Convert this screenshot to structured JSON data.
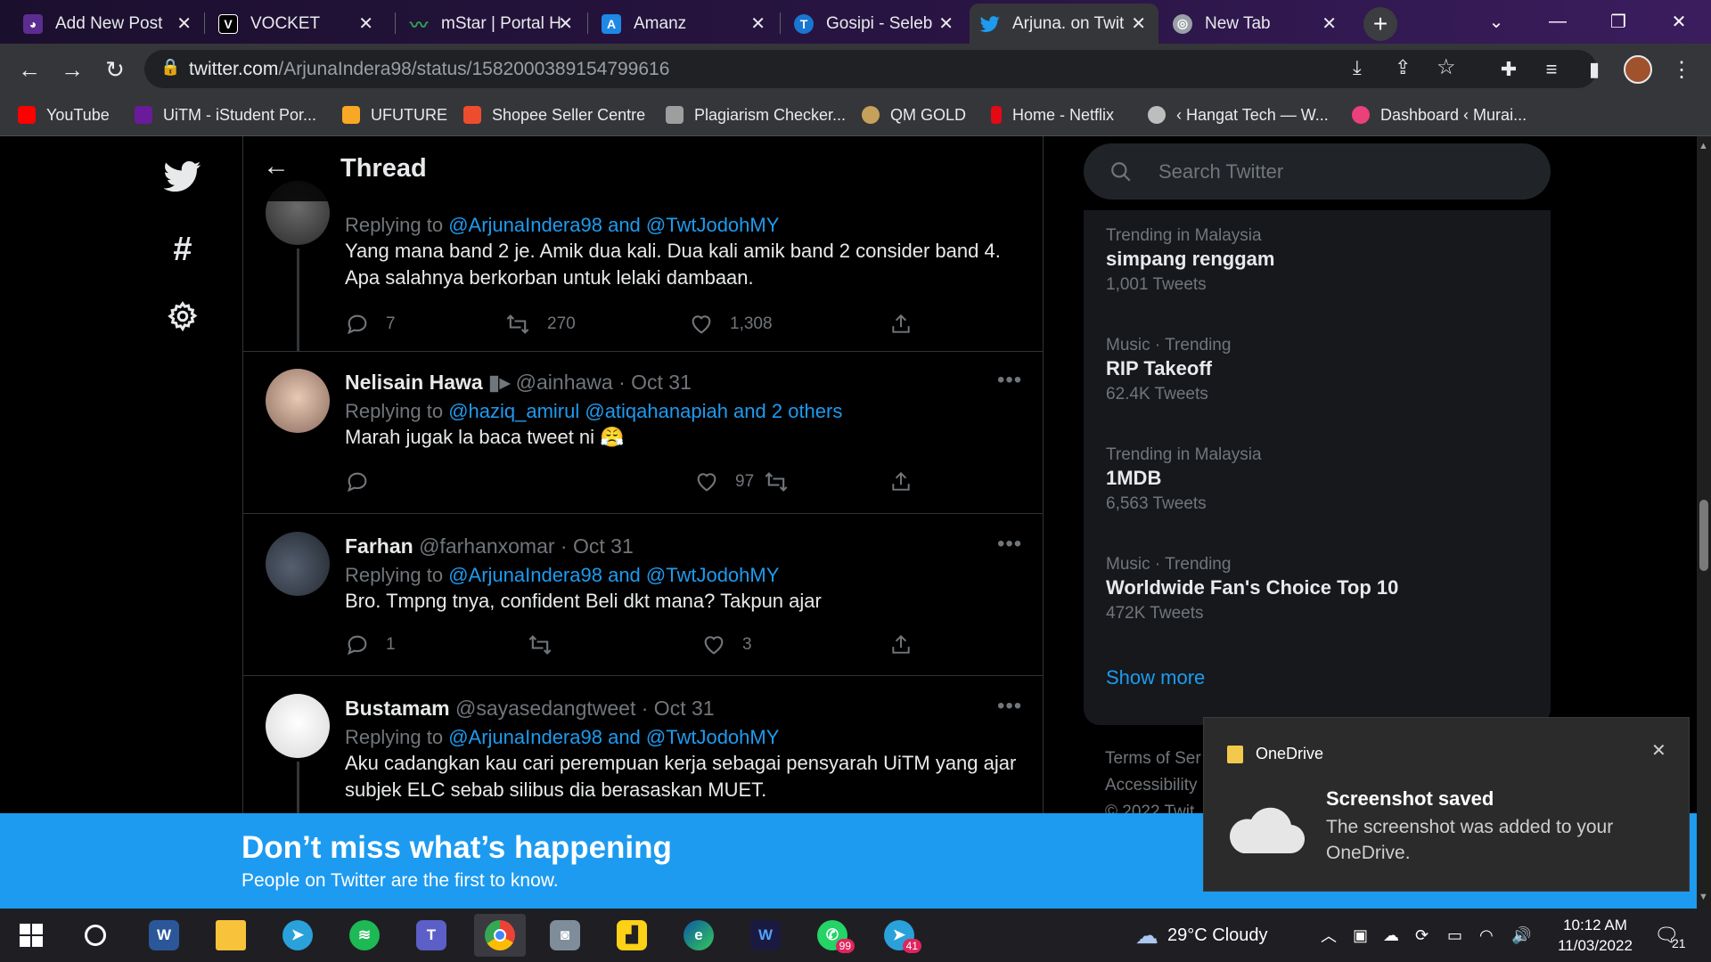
{
  "browser": {
    "tabs": [
      {
        "title": "Add New Post",
        "icon": "owl",
        "color": "#5c2d91",
        "active": false
      },
      {
        "title": "VOCKET",
        "icon": "v-logo",
        "color": "#000000",
        "active": false
      },
      {
        "title": "mStar | Portal H",
        "icon": "mstar",
        "color": "#2ea44f",
        "active": false
      },
      {
        "title": "Amanz",
        "icon": "amanz",
        "color": "#1e88e5",
        "active": false
      },
      {
        "title": "Gosipi - Seleb",
        "icon": "gosipi",
        "color": "#1976d2",
        "active": false
      },
      {
        "title": "Arjuna. on Twit",
        "icon": "twitter",
        "color": "#1d9bf0",
        "active": true
      },
      {
        "title": "New Tab",
        "icon": "chrome",
        "color": "#9aa0a6",
        "active": false
      }
    ],
    "new_tab_label": "+",
    "url_host": "twitter.com",
    "url_path": "/ArjunaIndera98/status/1582000389154799616",
    "bookmarks": [
      {
        "label": "YouTube",
        "color": "#ff0000"
      },
      {
        "label": "UiTM - iStudent Por...",
        "color": "#6a1b9a"
      },
      {
        "label": "UFUTURE",
        "color": "#f9a825"
      },
      {
        "label": "Shopee Seller Centre",
        "color": "#ee4d2d"
      },
      {
        "label": "Plagiarism Checker...",
        "color": "#9e9e9e"
      },
      {
        "label": "QM GOLD",
        "color": "#c6a15b"
      },
      {
        "label": "Home - Netflix",
        "color": "#e50914"
      },
      {
        "label": "‹ Hangat Tech — W...",
        "color": "#bdbdbd"
      },
      {
        "label": "Dashboard ‹ Murai...",
        "color": "#ec407a"
      }
    ]
  },
  "twitter": {
    "header_title": "Thread",
    "search_placeholder": "Search Twitter",
    "tweets": [
      {
        "name": "",
        "handle": "",
        "date": "",
        "replying_prefix": "Replying to ",
        "replying_to": "@ArjunaIndera98 and @TwtJodohMY",
        "text": "Yang mana band 2 je. Amik dua kali. Dua kali amik band 2 consider band 4. Apa salahnya berkorban untuk lelaki dambaan.",
        "replies": "7",
        "retweets": "270",
        "likes": "1,308"
      },
      {
        "name": "Nelisain Hawa",
        "handle": "@ainhawa · Oct 31",
        "replying_prefix": "Replying to ",
        "replying_to": "@haziq_amirul @atiqahanapiah and 2 others",
        "text": "Marah jugak la baca tweet ni 😤",
        "replies": "",
        "retweets": "",
        "likes": "97"
      },
      {
        "name": "Farhan",
        "handle": "@farhanxomar · Oct 31",
        "replying_prefix": "Replying to ",
        "replying_to": "@ArjunaIndera98 and @TwtJodohMY",
        "text": "Bro. Tmpng tnya, confident Beli dkt mana? Takpun ajar",
        "replies": "1",
        "retweets": "",
        "likes": "3"
      },
      {
        "name": "Bustamam",
        "handle": "@sayasedangtweet · Oct 31",
        "replying_prefix": "Replying to ",
        "replying_to": "@ArjunaIndera98 and @TwtJodohMY",
        "text": "Aku cadangkan kau cari perempuan kerja sebagai pensyarah UiTM yang ajar subjek ELC sebab silibus dia berasaskan MUET."
      }
    ],
    "trends": [
      {
        "meta": "Trending in Malaysia",
        "name": "simpang renggam",
        "count": "1,001 Tweets"
      },
      {
        "meta": "Music · Trending",
        "name": "RIP Takeoff",
        "count": "62.4K Tweets"
      },
      {
        "meta": "Trending in Malaysia",
        "name": "1MDB",
        "count": "6,563 Tweets"
      },
      {
        "meta": "Music · Trending",
        "name": "Worldwide Fan's Choice Top 10",
        "count": "472K Tweets"
      }
    ],
    "show_more": "Show more",
    "footer_terms": "Terms of Ser",
    "footer_access": "Accessibility",
    "footer_copy": "© 2022 Twit",
    "banner_title": "Don’t miss what’s happening",
    "banner_sub": "People on Twitter are the first to know."
  },
  "toast": {
    "app": "OneDrive",
    "title": "Screenshot saved",
    "body": "The screenshot was added to your OneDrive."
  },
  "taskbar": {
    "weather": "29°C  Cloudy",
    "time": "10:12 AM",
    "date": "11/03/2022",
    "notif_count": "21",
    "whatsapp_badge": "99",
    "telegram_badge": "41"
  },
  "colors": {
    "twitter_blue": "#1d9bf0",
    "background": "#000000",
    "muted": "#71767b"
  }
}
